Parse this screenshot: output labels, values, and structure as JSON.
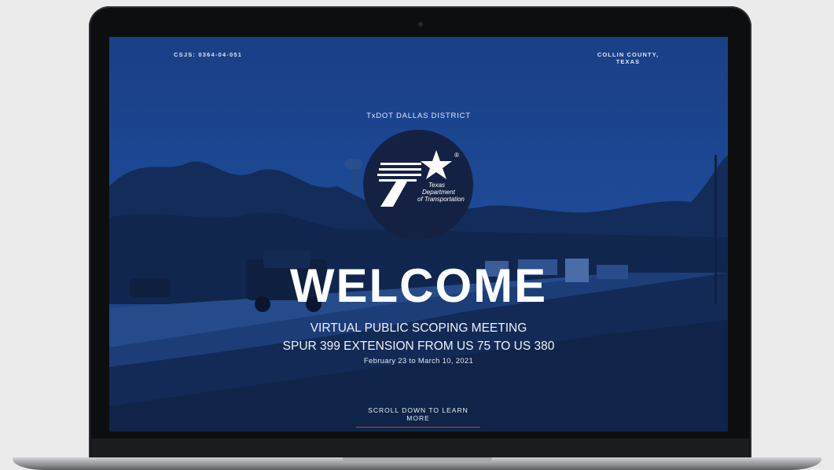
{
  "screen": {
    "csjs": "CSJS: 0364-04-051",
    "county_line1": "COLLIN COUNTY,",
    "county_line2": "TEXAS",
    "district": "TxDOT DALLAS DISTRICT",
    "logo": {
      "text_line1": "Texas",
      "text_line2": "Department",
      "text_line3": "of Transportation",
      "registered_mark": "®"
    },
    "headline": "WELCOME",
    "subtitle_line1": "VIRTUAL PUBLIC SCOPING MEETING",
    "subtitle_line2": "SPUR 399 EXTENSION FROM US 75 TO US 380",
    "dates": "February 23 to March 10, 2021",
    "scroll_cta": "SCROLL DOWN TO LEARN MORE"
  },
  "colors": {
    "overlay_blue": "#173a7c",
    "logo_navy": "#152143",
    "cta_underline": "#d2374a"
  }
}
